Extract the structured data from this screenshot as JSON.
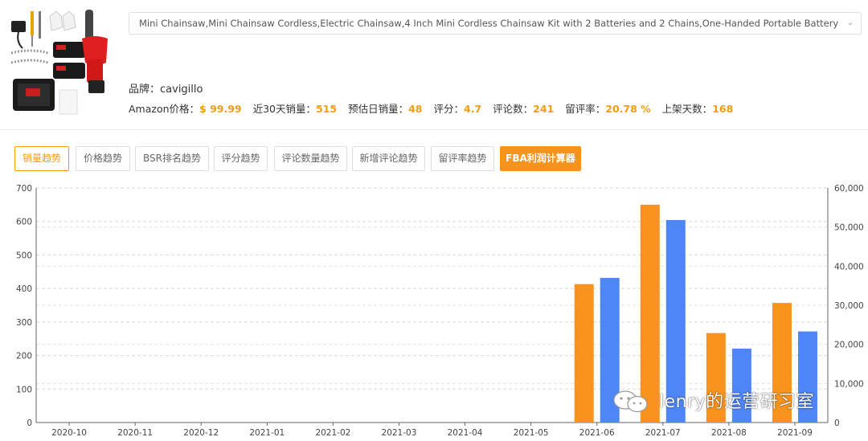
{
  "product": {
    "title": "Mini Chainsaw,Mini Chainsaw Cordless,Electric Chainsaw,4 Inch Mini Cordless Chainsaw Kit with 2 Batteries and 2 Chains,One-Handed Portable Battery Chainsaw for Garden Bush Bran",
    "brand_label": "品牌：",
    "brand": "cavigillo",
    "stats": [
      {
        "label": "Amazon价格：",
        "value": "$ 99.99"
      },
      {
        "label": "近30天销量：",
        "value": "515"
      },
      {
        "label": "预估日销量：",
        "value": "48"
      },
      {
        "label": "评分：",
        "value": "4.7"
      },
      {
        "label": "评论数：",
        "value": "241"
      },
      {
        "label": "留评率：",
        "value": "20.78 %"
      },
      {
        "label": "上架天数：",
        "value": "168"
      }
    ]
  },
  "tabs": [
    {
      "label": "销量趋势",
      "state": "active"
    },
    {
      "label": "价格趋势",
      "state": "normal"
    },
    {
      "label": "BSR排名趋势",
      "state": "normal"
    },
    {
      "label": "评分趋势",
      "state": "normal"
    },
    {
      "label": "评论数量趋势",
      "state": "normal"
    },
    {
      "label": "新增评论趋势",
      "state": "normal"
    },
    {
      "label": "留评率趋势",
      "state": "normal"
    },
    {
      "label": "FBA利润计算器",
      "state": "primary"
    }
  ],
  "colors": {
    "accent": "#f39c12",
    "bar_left": "#f7931e",
    "bar_right": "#4f86f7"
  },
  "chart_data": {
    "type": "bar",
    "categories": [
      "2020-10",
      "2020-11",
      "2020-12",
      "2021-01",
      "2021-02",
      "2021-03",
      "2021-04",
      "2021-05",
      "2021-06",
      "2021-07",
      "2021-08",
      "2021-09"
    ],
    "series": [
      {
        "axis": "left",
        "color": "#f7931e",
        "values": [
          0,
          0,
          0,
          0,
          0,
          0,
          0,
          0,
          413,
          650,
          267,
          357
        ]
      },
      {
        "axis": "right",
        "color": "#4f86f7",
        "values": [
          0,
          0,
          0,
          0,
          0,
          0,
          0,
          0,
          37000,
          51800,
          18900,
          23300
        ]
      }
    ],
    "y_left": {
      "min": 0,
      "max": 700,
      "ticks": [
        "0",
        "100",
        "200",
        "300",
        "400",
        "500",
        "600",
        "700"
      ]
    },
    "y_right": {
      "min": 0,
      "max": 60000,
      "ticks": [
        "0",
        "10,000",
        "20,000",
        "30,000",
        "40,000",
        "50,000",
        "60,000"
      ]
    },
    "grid": "dashed horizontal"
  },
  "watermark": {
    "text": "lenry的运营研习室",
    "icon": "wechat-icon"
  }
}
